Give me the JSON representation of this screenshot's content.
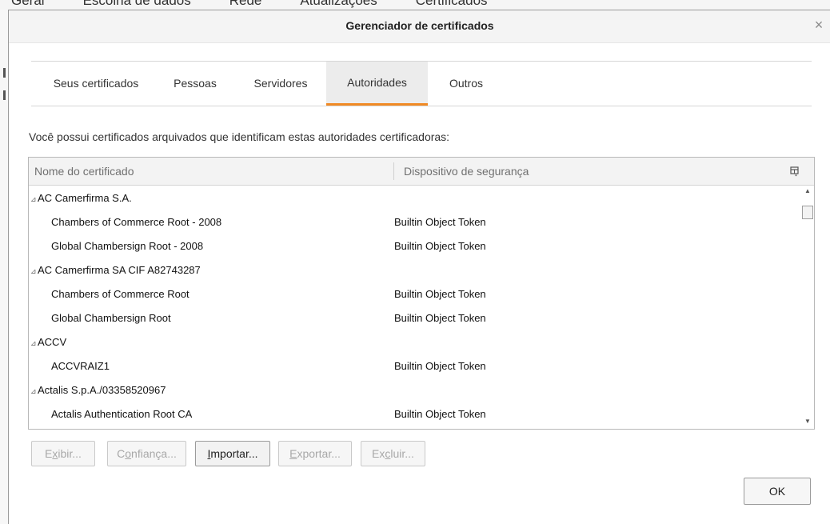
{
  "background": {
    "tabs": [
      "Geral",
      "Escolha de dados",
      "Rede",
      "Atualizações",
      "Certificados"
    ]
  },
  "dialog": {
    "title": "Gerenciador de certificados",
    "close_glyph": "×",
    "tabs": [
      {
        "label": "Seus certificados",
        "active": false
      },
      {
        "label": "Pessoas",
        "active": false
      },
      {
        "label": "Servidores",
        "active": false
      },
      {
        "label": "Autoridades",
        "active": true
      },
      {
        "label": "Outros",
        "active": false
      }
    ],
    "description": "Você possui certificados arquivados que identificam estas autoridades certificadoras:",
    "columns": {
      "name": "Nome do certificado",
      "device": "Dispositivo de segurança"
    },
    "rows": [
      {
        "type": "parent",
        "name": "AC Camerfirma S.A.",
        "device": ""
      },
      {
        "type": "child",
        "name": "Chambers of Commerce Root - 2008",
        "device": "Builtin Object Token"
      },
      {
        "type": "child",
        "name": "Global Chambersign Root - 2008",
        "device": "Builtin Object Token"
      },
      {
        "type": "parent",
        "name": "AC Camerfirma SA CIF A82743287",
        "device": ""
      },
      {
        "type": "child",
        "name": "Chambers of Commerce Root",
        "device": "Builtin Object Token"
      },
      {
        "type": "child",
        "name": "Global Chambersign Root",
        "device": "Builtin Object Token"
      },
      {
        "type": "parent",
        "name": "ACCV",
        "device": ""
      },
      {
        "type": "child",
        "name": "ACCVRAIZ1",
        "device": "Builtin Object Token"
      },
      {
        "type": "parent",
        "name": "Actalis S.p.A./03358520967",
        "device": ""
      },
      {
        "type": "child",
        "name": "Actalis Authentication Root CA",
        "device": "Builtin Object Token"
      }
    ],
    "buttons": {
      "view": {
        "label": "Exibir...",
        "accesskey": "x",
        "enabled": false
      },
      "trust": {
        "label": "Confiança...",
        "accesskey": "o",
        "enabled": false
      },
      "import": {
        "label": "Importar...",
        "accesskey": "I",
        "enabled": true
      },
      "export": {
        "label": "Exportar...",
        "accesskey": "E",
        "enabled": false
      },
      "delete": {
        "label": "Excluir...",
        "accesskey": "c",
        "enabled": false
      }
    },
    "ok_label": "OK"
  },
  "colors": {
    "accent": "#f08a24",
    "disabled_text": "#a8a8a8"
  }
}
